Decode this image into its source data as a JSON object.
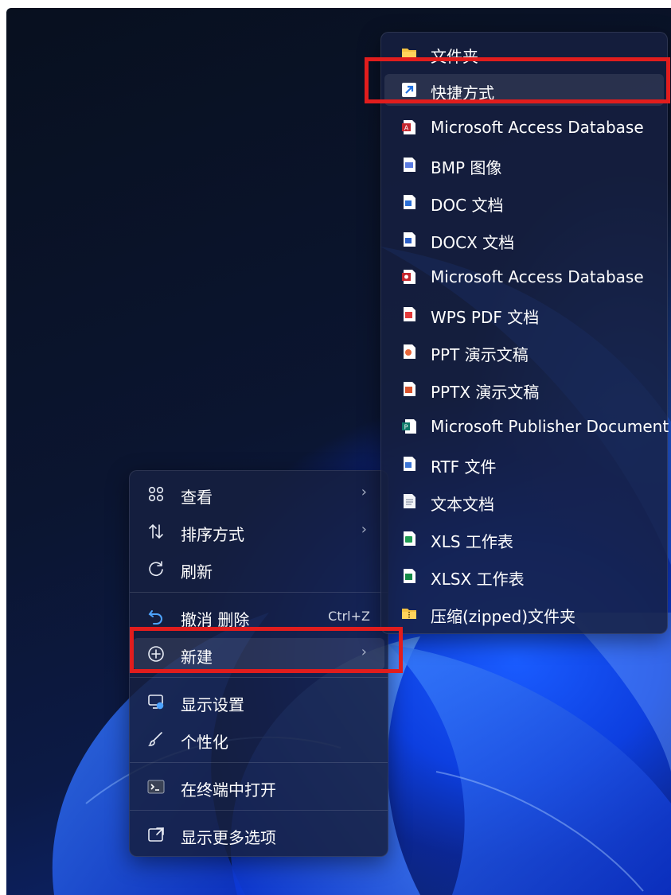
{
  "context_menu": {
    "items": [
      {
        "label": "查看",
        "icon": "grid-view-icon",
        "has_submenu": true
      },
      {
        "label": "排序方式",
        "icon": "sort-arrows-icon",
        "has_submenu": true
      },
      {
        "label": "刷新",
        "icon": "refresh-icon",
        "has_submenu": false
      },
      {
        "label": "撤消 删除",
        "icon": "undo-icon",
        "shortcut": "Ctrl+Z"
      },
      {
        "label": "新建",
        "icon": "plus-circle-icon",
        "has_submenu": true,
        "highlighted": true
      },
      {
        "label": "显示设置",
        "icon": "display-settings-icon"
      },
      {
        "label": "个性化",
        "icon": "brush-icon"
      },
      {
        "label": "在终端中打开",
        "icon": "terminal-icon"
      },
      {
        "label": "显示更多选项",
        "icon": "more-options-icon"
      }
    ],
    "arrow_glyph": "›"
  },
  "new_submenu": {
    "items": [
      {
        "label": "文件夹",
        "icon": "folder-icon"
      },
      {
        "label": "快捷方式",
        "icon": "shortcut-icon",
        "highlighted": true
      },
      {
        "label": "Microsoft Access Database",
        "icon": "access-db-icon"
      },
      {
        "label": "BMP 图像",
        "icon": "bmp-image-icon"
      },
      {
        "label": "DOC 文档",
        "icon": "doc-icon"
      },
      {
        "label": "DOCX 文档",
        "icon": "docx-icon"
      },
      {
        "label": "Microsoft Access Database",
        "icon": "access-db-icon"
      },
      {
        "label": "WPS PDF 文档",
        "icon": "pdf-icon"
      },
      {
        "label": "PPT 演示文稿",
        "icon": "ppt-icon"
      },
      {
        "label": "PPTX 演示文稿",
        "icon": "pptx-icon"
      },
      {
        "label": "Microsoft Publisher Document",
        "icon": "publisher-icon"
      },
      {
        "label": "RTF 文件",
        "icon": "rtf-icon"
      },
      {
        "label": "文本文档",
        "icon": "text-document-icon"
      },
      {
        "label": "XLS 工作表",
        "icon": "xls-icon"
      },
      {
        "label": "XLSX 工作表",
        "icon": "xlsx-icon"
      },
      {
        "label": "压缩(zipped)文件夹",
        "icon": "zip-folder-icon"
      }
    ]
  },
  "colors": {
    "highlight_box": "#e11d1d",
    "menu_background": "#162040",
    "wallpaper_blue": "#1a5cff"
  }
}
